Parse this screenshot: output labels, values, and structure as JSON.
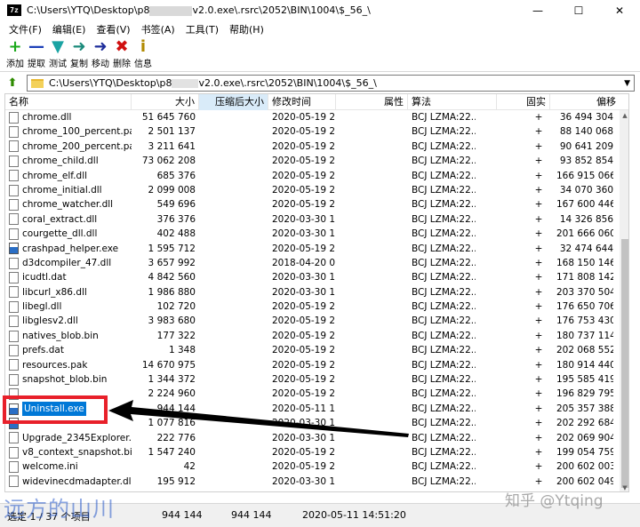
{
  "window": {
    "title_prefix": "C:\\Users\\YTQ\\Desktop\\p8",
    "title_suffix": "v2.0.exe\\.rsrc\\2052\\BIN\\1004\\$_56_\\",
    "app_icon_text": "7z",
    "minimize": "—",
    "maximize": "☐",
    "close": "✕"
  },
  "menu": [
    "文件(F)",
    "编辑(E)",
    "查看(V)",
    "书签(A)",
    "工具(T)",
    "帮助(H)"
  ],
  "toolbar": [
    {
      "label": "添加",
      "icon": "plus-icon",
      "glyph": "+",
      "color": "#1aa81a"
    },
    {
      "label": "提取",
      "icon": "minus-icon",
      "glyph": "—",
      "color": "#1c3fb8"
    },
    {
      "label": "测试",
      "icon": "check-icon",
      "glyph": "▼",
      "color": "#1aa3a3"
    },
    {
      "label": "复制",
      "icon": "copy-arrow-icon",
      "glyph": "➜",
      "color": "#1a8a7a"
    },
    {
      "label": "移动",
      "icon": "move-arrow-icon",
      "glyph": "➜",
      "color": "#1c2c9a"
    },
    {
      "label": "删除",
      "icon": "delete-x-icon",
      "glyph": "✖",
      "color": "#d01010"
    },
    {
      "label": "信息",
      "icon": "info-icon",
      "glyph": "i",
      "color": "#b08a00"
    }
  ],
  "address": {
    "prefix": "C:\\Users\\YTQ\\Desktop\\p8",
    "suffix": "v2.0.exe\\.rsrc\\2052\\BIN\\1004\\$_56_\\"
  },
  "columns": {
    "name": "名称",
    "size": "大小",
    "packed": "压缩后大小",
    "mtime": "修改时间",
    "attr": "属性",
    "method": "算法",
    "solid": "固实",
    "offset": "偏移"
  },
  "files": [
    {
      "name": "chrome.dll",
      "size": "51 645 760",
      "mtime": "2020-05-19 2...",
      "method": "BCJ LZMA:22...",
      "solid": "+",
      "offset": "36 494 304",
      "icon": "file"
    },
    {
      "name": "chrome_100_percent.pak",
      "size": "2 501 137",
      "mtime": "2020-05-19 2...",
      "method": "BCJ LZMA:22...",
      "solid": "+",
      "offset": "88 140 068",
      "icon": "file"
    },
    {
      "name": "chrome_200_percent.pak",
      "size": "3 211 641",
      "mtime": "2020-05-19 2...",
      "method": "BCJ LZMA:22...",
      "solid": "+",
      "offset": "90 641 209",
      "icon": "file"
    },
    {
      "name": "chrome_child.dll",
      "size": "73 062 208",
      "mtime": "2020-05-19 2...",
      "method": "BCJ LZMA:22...",
      "solid": "+",
      "offset": "93 852 854",
      "icon": "file"
    },
    {
      "name": "chrome_elf.dll",
      "size": "685 376",
      "mtime": "2020-05-19 2...",
      "method": "BCJ LZMA:22...",
      "solid": "+",
      "offset": "166 915 066",
      "icon": "file"
    },
    {
      "name": "chrome_initial.dll",
      "size": "2 099 008",
      "mtime": "2020-05-19 2...",
      "method": "BCJ LZMA:22...",
      "solid": "+",
      "offset": "34 070 360",
      "icon": "file"
    },
    {
      "name": "chrome_watcher.dll",
      "size": "549 696",
      "mtime": "2020-05-19 2...",
      "method": "BCJ LZMA:22...",
      "solid": "+",
      "offset": "167 600 446",
      "icon": "file"
    },
    {
      "name": "coral_extract.dll",
      "size": "376 376",
      "mtime": "2020-03-30 1...",
      "method": "BCJ LZMA:22...",
      "solid": "+",
      "offset": "14 326 856",
      "icon": "file"
    },
    {
      "name": "courgette_dll.dll",
      "size": "402 488",
      "mtime": "2020-03-30 1...",
      "method": "BCJ LZMA:22...",
      "solid": "+",
      "offset": "201 666 060",
      "icon": "file"
    },
    {
      "name": "crashpad_helper.exe",
      "size": "1 595 712",
      "mtime": "2020-05-19 2...",
      "method": "BCJ LZMA:22...",
      "solid": "+",
      "offset": "32 474 644",
      "icon": "exe"
    },
    {
      "name": "d3dcompiler_47.dll",
      "size": "3 657 992",
      "mtime": "2018-04-20 0...",
      "method": "BCJ LZMA:22...",
      "solid": "+",
      "offset": "168 150 146",
      "icon": "file"
    },
    {
      "name": "icudtl.dat",
      "size": "4 842 560",
      "mtime": "2020-03-30 1...",
      "method": "BCJ LZMA:22...",
      "solid": "+",
      "offset": "171 808 142",
      "icon": "file"
    },
    {
      "name": "libcurl_x86.dll",
      "size": "1 986 880",
      "mtime": "2020-03-30 1...",
      "method": "BCJ LZMA:22...",
      "solid": "+",
      "offset": "203 370 504",
      "icon": "file"
    },
    {
      "name": "libegl.dll",
      "size": "102 720",
      "mtime": "2020-05-19 2...",
      "method": "BCJ LZMA:22...",
      "solid": "+",
      "offset": "176 650 706",
      "icon": "file"
    },
    {
      "name": "libglesv2.dll",
      "size": "3 983 680",
      "mtime": "2020-05-19 2...",
      "method": "BCJ LZMA:22...",
      "solid": "+",
      "offset": "176 753 430",
      "icon": "file"
    },
    {
      "name": "natives_blob.bin",
      "size": "177 322",
      "mtime": "2020-05-19 2...",
      "method": "BCJ LZMA:22...",
      "solid": "+",
      "offset": "180 737 114",
      "icon": "file"
    },
    {
      "name": "prefs.dat",
      "size": "1 348",
      "mtime": "2020-05-19 2...",
      "method": "BCJ LZMA:22...",
      "solid": "+",
      "offset": "202 068 552",
      "icon": "file"
    },
    {
      "name": "resources.pak",
      "size": "14 670 975",
      "mtime": "2020-05-19 2...",
      "method": "BCJ LZMA:22...",
      "solid": "+",
      "offset": "180 914 440",
      "icon": "file"
    },
    {
      "name": "snapshot_blob.bin",
      "size": "1 344 372",
      "mtime": "2020-05-19 2...",
      "method": "BCJ LZMA:22...",
      "solid": "+",
      "offset": "195 585 419",
      "icon": "file"
    },
    {
      "name": "",
      "size": "2 224 960",
      "mtime": "2020-05-19 2...",
      "method": "BCJ LZMA:22...",
      "solid": "+",
      "offset": "196 829 795",
      "icon": "file"
    },
    {
      "name": "Uninstall.exe",
      "size": "944 144",
      "mtime": "2020-05-11 1...",
      "method": "BCJ LZMA:22...",
      "solid": "+",
      "offset": "205 357 388",
      "icon": "exe",
      "selected": true
    },
    {
      "name": "",
      "size": "1 077 816",
      "mtime": "2020-03-30 1...",
      "method": "BCJ LZMA:22...",
      "solid": "+",
      "offset": "202 292 684",
      "icon": "exe"
    },
    {
      "name": "Upgrade_2345Explorer....",
      "size": "222 776",
      "mtime": "2020-03-30 1...",
      "method": "BCJ LZMA:22...",
      "solid": "+",
      "offset": "202 069 904",
      "icon": "file"
    },
    {
      "name": "v8_context_snapshot.bin",
      "size": "1 547 240",
      "mtime": "2020-05-19 2...",
      "method": "BCJ LZMA:22...",
      "solid": "+",
      "offset": "199 054 759",
      "icon": "file"
    },
    {
      "name": "welcome.ini",
      "size": "42",
      "mtime": "2020-05-19 2...",
      "method": "BCJ LZMA:22...",
      "solid": "+",
      "offset": "200 602 003",
      "icon": "file"
    },
    {
      "name": "widevinecdmadapter.dll",
      "size": "195 912",
      "mtime": "2020-03-30 1...",
      "method": "BCJ LZMA:22...",
      "solid": "+",
      "offset": "200 602 049",
      "icon": "file"
    }
  ],
  "status": {
    "selection": "选定 1 / 37 个项目",
    "size": "944 144",
    "packed": "944 144",
    "mtime": "2020-05-11 14:51:20"
  },
  "watermarks": {
    "left": "远方的山川",
    "right": "知乎 @Ytqing"
  },
  "colors": {
    "selection": "#0078d7",
    "annotation": "#e8202a",
    "sorted_header": "#d9ebf9"
  }
}
